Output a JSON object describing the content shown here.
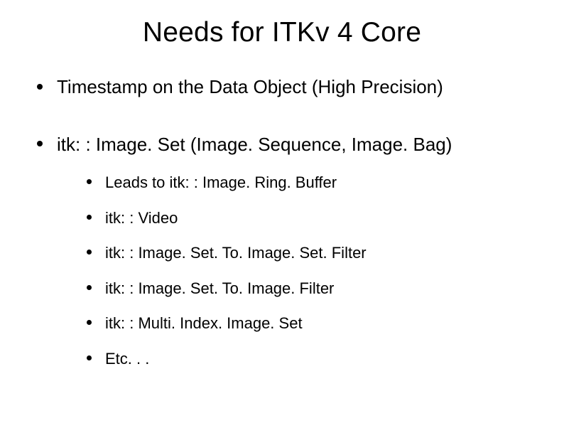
{
  "title": "Needs for ITKv 4 Core",
  "bullets": [
    {
      "text": "Timestamp on the Data Object (High Precision)"
    },
    {
      "text": "itk: : Image. Set (Image. Sequence, Image. Bag)",
      "children": [
        {
          "text": "Leads to itk: : Image. Ring. Buffer"
        },
        {
          "text": "itk: : Video"
        },
        {
          "text": "itk: : Image. Set. To. Image. Set. Filter"
        },
        {
          "text": "itk: : Image. Set. To. Image. Filter"
        },
        {
          "text": "itk: : Multi. Index. Image. Set"
        },
        {
          "text": "Etc. . ."
        }
      ]
    }
  ]
}
